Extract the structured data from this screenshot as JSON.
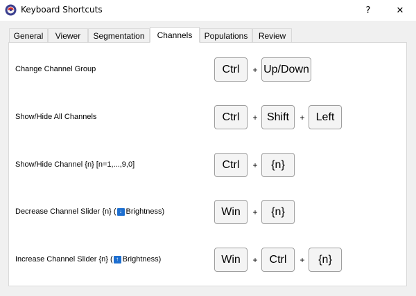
{
  "window": {
    "title": "Keyboard Shortcuts",
    "help_label": "?",
    "close_label": "✕"
  },
  "tabs": [
    {
      "label": "General",
      "active": false
    },
    {
      "label": "Viewer",
      "active": false
    },
    {
      "label": "Segmentation",
      "active": false
    },
    {
      "label": "Channels",
      "active": true
    },
    {
      "label": "Populations",
      "active": false
    },
    {
      "label": "Review",
      "active": false
    }
  ],
  "plus_symbol": "+",
  "shortcuts": [
    {
      "label": "Change Channel Group",
      "keys": [
        "Ctrl",
        "Up/Down"
      ]
    },
    {
      "label": "Show/Hide All Channels",
      "keys": [
        "Ctrl",
        "Shift",
        "Left"
      ]
    },
    {
      "label": "Show/Hide Channel {n} [n=1,...,9,0]",
      "keys": [
        "Ctrl",
        "{n}"
      ]
    },
    {
      "label_before": "Decrease Channel Slider {n} (",
      "badge": "↓",
      "label_after": " Brightness)",
      "keys": [
        "Win",
        "{n}"
      ]
    },
    {
      "label_before": "Increase Channel Slider {n} (",
      "badge": "↑",
      "label_after": " Brightness)",
      "keys": [
        "Win",
        "Ctrl",
        "{n}"
      ]
    }
  ],
  "colors": {
    "accent_badge": "#1e6fd0",
    "pane_background": "#ffffff",
    "window_background": "#f0f0f0"
  }
}
